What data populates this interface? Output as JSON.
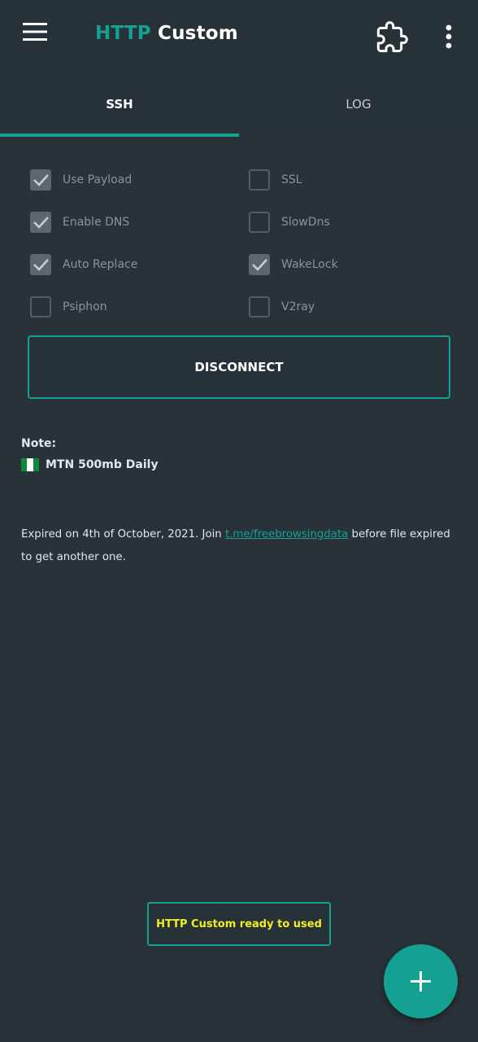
{
  "app_bar": {
    "title_accent": "HTTP",
    "title_rest": "Custom",
    "menu_icon": "hamburger-menu-icon",
    "plugin_icon": "puzzle-icon",
    "more_icon": "more-vert-icon"
  },
  "tabs": [
    {
      "label": "SSH",
      "selected": true
    },
    {
      "label": "LOG",
      "selected": false
    }
  ],
  "options": {
    "left": [
      {
        "label": "Use Payload",
        "checked": true
      },
      {
        "label": "Enable DNS",
        "checked": true
      },
      {
        "label": "Auto Replace",
        "checked": true
      },
      {
        "label": "Psiphon",
        "checked": false
      }
    ],
    "right": [
      {
        "label": "SSL",
        "checked": false
      },
      {
        "label": "SlowDns",
        "checked": false
      },
      {
        "label": "WakeLock",
        "checked": true
      },
      {
        "label": "V2ray",
        "checked": false
      }
    ]
  },
  "disconnect_label": "DISCONNECT",
  "note": {
    "label": "Note:",
    "plan": "MTN 500mb Daily",
    "flag_icon": "nigeria-flag-icon",
    "expiry_text": "Expired on 4th of October, 2021. Join",
    "link_text": "t.me/freebrowsingdata",
    "expiry_text_after": "before file expired to get another one."
  },
  "toast": "HTTP Custom ready to used",
  "fab_icon": "plus-icon",
  "colors": {
    "accent": "#14a192",
    "background": "#263238",
    "toast_text": "#f4ee1e"
  }
}
